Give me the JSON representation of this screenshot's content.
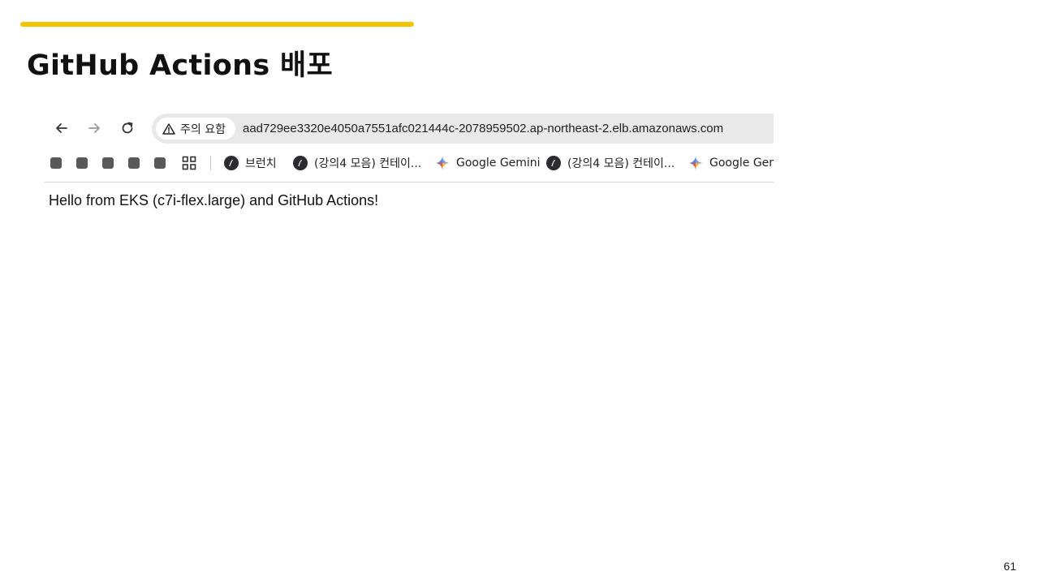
{
  "slide": {
    "title": "GitHub Actions 배포",
    "accent_color": "#F5C400",
    "page_number": "61"
  },
  "browser": {
    "nav": {
      "back_icon": "arrow-left-icon",
      "forward_icon": "arrow-right-icon",
      "reload_icon": "reload-icon"
    },
    "security_chip": {
      "icon": "warning-triangle-icon",
      "label": "주의 요함"
    },
    "url": "aad729ee3320e4050a7551afc021444c-2078959502.ap-northeast-2.elb.amazonaws.com",
    "bookmarks": {
      "app_grid_icon": "apps-grid-icon",
      "items": [
        {
          "icon": "dark-circle-icon",
          "label": "브런치"
        },
        {
          "icon": "dark-circle-icon",
          "label": "(강의4 모음) 컨테이..."
        },
        {
          "icon": "gemini-sparkle-icon",
          "label": "Google Gemini"
        },
        {
          "icon": "dark-circle-icon",
          "label": "(강의4 모음) 컨테이..."
        },
        {
          "icon": "gemini-sparkle-icon",
          "label": "Google Gem"
        }
      ]
    },
    "page_text": "Hello from EKS (c7i-flex.large) and GitHub Actions!"
  }
}
